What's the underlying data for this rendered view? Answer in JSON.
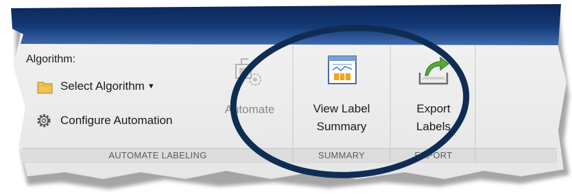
{
  "automate_labeling": {
    "algorithm_label": "Algorithm:",
    "select_algorithm": "Select Algorithm",
    "select_algorithm_caret": "▼",
    "configure_automation": "Configure Automation",
    "automate_button": "Automate",
    "section_title": "AUTOMATE LABELING"
  },
  "summary": {
    "view_label_summary_line1": "View Label",
    "view_label_summary_line2": "Summary",
    "section_title": "SUMMARY"
  },
  "export": {
    "export_labels_line1": "Export",
    "export_labels_line2": "Labels",
    "section_title": "EXPORT"
  },
  "colors": {
    "banner_dark": "#0e2e62",
    "banner_light": "#3c66a8",
    "toolstrip_bg": "#eeeeee",
    "section_bar": "#dcdcdc",
    "annotation_circle": "#0f2d54",
    "folder_yellow": "#f2c44d",
    "export_arrow_green": "#5aa83a"
  }
}
